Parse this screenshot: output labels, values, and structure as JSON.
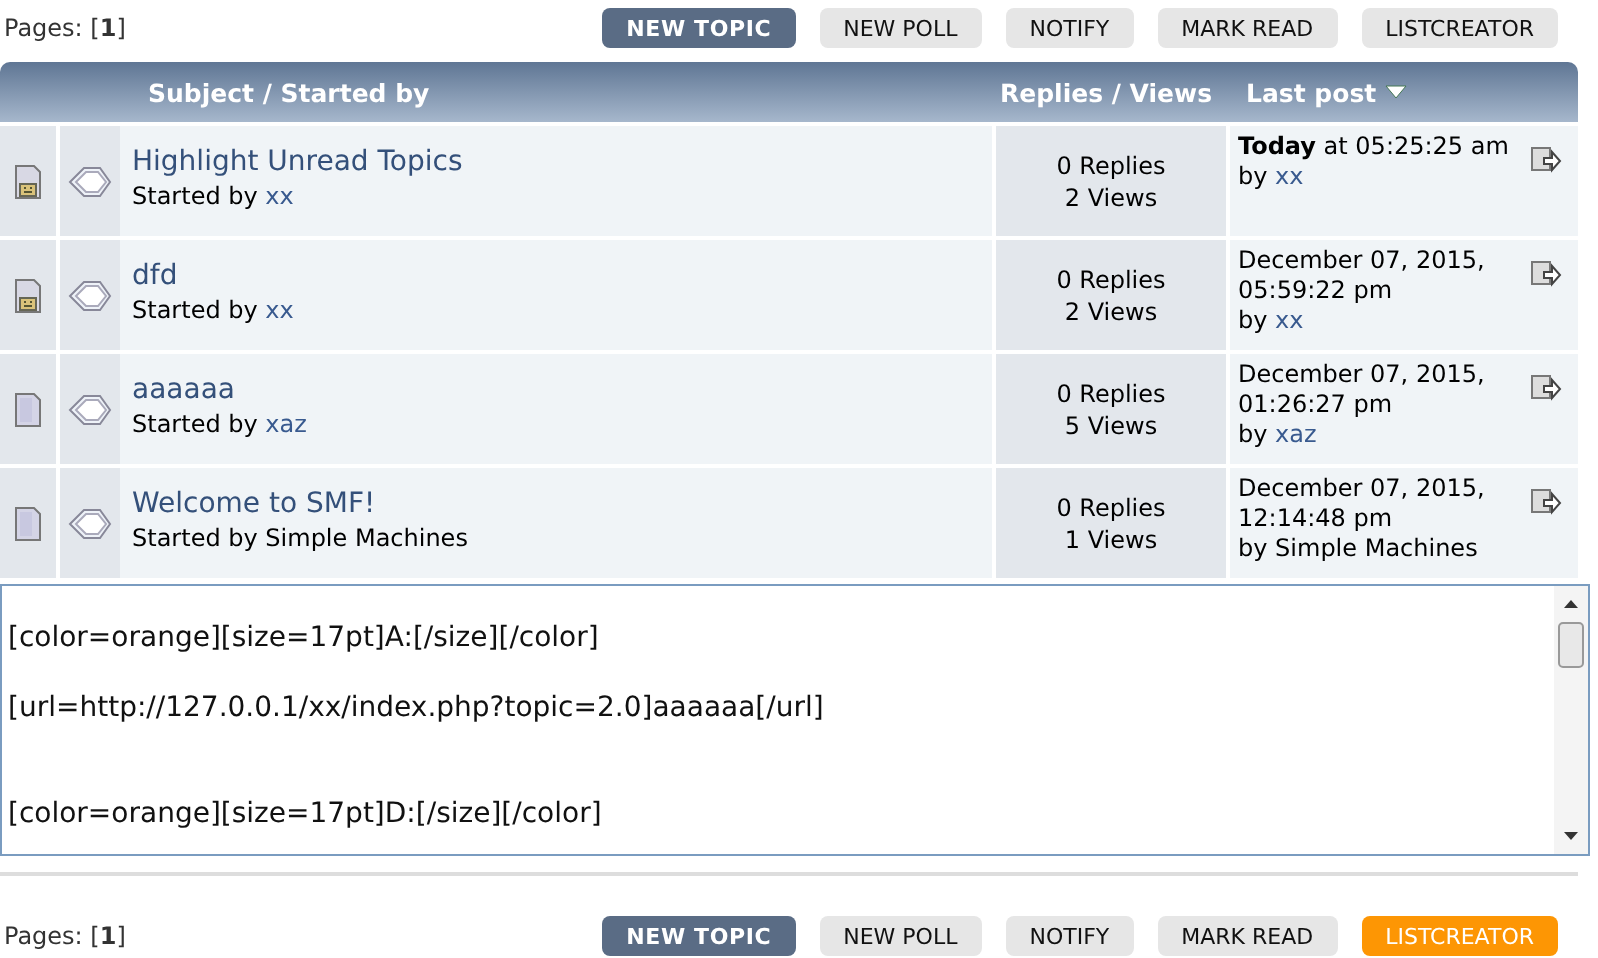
{
  "top_bar": {
    "pages_label": "Pages: [",
    "page": "1",
    "pages_end": "]",
    "buttons": [
      {
        "label": "NEW TOPIC",
        "kind": "primary"
      },
      {
        "label": "NEW POLL",
        "kind": "plain"
      },
      {
        "label": "NOTIFY",
        "kind": "plain"
      },
      {
        "label": "MARK READ",
        "kind": "plain"
      },
      {
        "label": "LISTCREATOR",
        "kind": "plain"
      }
    ]
  },
  "table": {
    "columns": [
      "Subject / Started by",
      "Replies / Views",
      "Last post"
    ],
    "rows": [
      {
        "participated": true,
        "subject": "Highlight Unread Topics",
        "started_by": "Started by",
        "author": "xx",
        "author_link": true,
        "replies": "0 Replies",
        "views": "2 Views",
        "last_post": "**Today** at 05:25:25 am",
        "last_by": "by",
        "last_author": "xx",
        "last_author_link": true
      },
      {
        "participated": true,
        "subject": "dfd",
        "started_by": "Started by",
        "author": "xx",
        "author_link": true,
        "replies": "0 Replies",
        "views": "2 Views",
        "last_post": "December 07, 2015, 05:59:22 pm",
        "last_by": "by",
        "last_author": "xx",
        "last_author_link": true
      },
      {
        "participated": false,
        "subject": "aaaaaa",
        "started_by": "Started by",
        "author": "xaz",
        "author_link": true,
        "replies": "0 Replies",
        "views": "5 Views",
        "last_post": "December 07, 2015, 01:26:27 pm",
        "last_by": "by",
        "last_author": "xaz",
        "last_author_link": true
      },
      {
        "participated": false,
        "subject": "Welcome to SMF!",
        "started_by": "Started by",
        "author": "Simple Machines",
        "author_link": false,
        "replies": "0 Replies",
        "views": "1 Views",
        "last_post": "December 07, 2015, 12:14:48 pm",
        "last_by": "by",
        "last_author": "Simple Machines",
        "last_author_link": false
      }
    ]
  },
  "text_area": {
    "value": "\n[color=orange][size=17pt]A:[/size][/color]\n\n[url=http://127.0.0.1/xx/index.php?topic=2.0]aaaaaa[/url]\n\n\n[color=orange][size=17pt]D:[/size][/color]"
  },
  "bottom_bar": {
    "pages_label": "Pages: [",
    "page": "1",
    "pages_end": "]",
    "buttons": [
      {
        "label": "NEW TOPIC",
        "kind": "primary"
      },
      {
        "label": "NEW POLL",
        "kind": "plain"
      },
      {
        "label": "NOTIFY",
        "kind": "plain"
      },
      {
        "label": "MARK READ",
        "kind": "plain"
      },
      {
        "label": "LISTCREATOR",
        "kind": "hover"
      }
    ]
  }
}
